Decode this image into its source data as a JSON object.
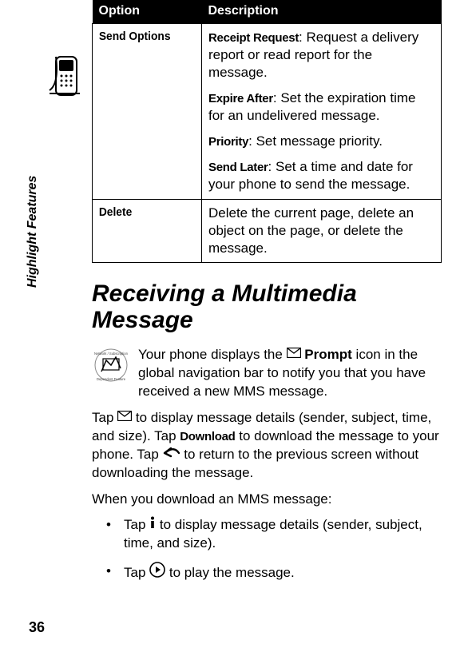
{
  "sidebar": {
    "section_label": "Highlight Features",
    "page_number": "36"
  },
  "table": {
    "head_option": "Option",
    "head_desc": "Description",
    "row1": {
      "name": "Send Options",
      "sub1": {
        "label": "Receipt Request",
        "text": ": Request a delivery report or read report for the message."
      },
      "sub2": {
        "label": "Expire After",
        "text": ": Set the expiration time for an undelivered message."
      },
      "sub3": {
        "label": "Priority",
        "text": ": Set message priority."
      },
      "sub4": {
        "label": "Send Later",
        "text": ": Set a time and date for your phone to send the message."
      }
    },
    "row2": {
      "name": "Delete",
      "text": "Delete the current page, delete an object on the page, or delete the message."
    }
  },
  "heading": "Receiving a Multimedia Message",
  "p1": {
    "pre": "Your phone displays the ",
    "prompt": " Prompt",
    "post": " icon in the global navigation bar to notify you that you have received a new MMS message."
  },
  "p2": {
    "pre": "Tap ",
    "mid1": " to display message details (sender, subject, time, and size). Tap ",
    "download": "Download",
    "mid2": " to download the message to your phone. Tap ",
    "post": " to return to the previous screen without downloading the message."
  },
  "p3": "When you download an MMS message:",
  "b1": {
    "pre": "Tap ",
    "post": " to display message details (sender, subject, time, and size)."
  },
  "b2": {
    "pre": "Tap ",
    "post": " to play the message."
  }
}
